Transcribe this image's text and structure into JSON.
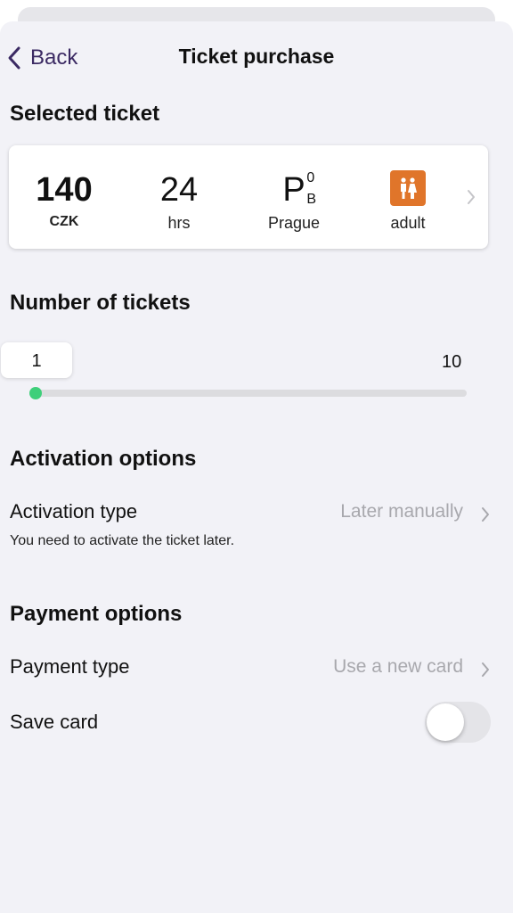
{
  "nav": {
    "back_label": "Back",
    "title": "Ticket purchase"
  },
  "selected_ticket": {
    "heading": "Selected ticket",
    "price": "140",
    "currency": "CZK",
    "duration": "24",
    "duration_unit": "hrs",
    "zone_letter": "P",
    "zone_sup": "0",
    "zone_sub": "B",
    "zone_name": "Prague",
    "passenger_icon": "adult-passenger-icon",
    "passenger_type": "adult",
    "accent_color": "#e0752a"
  },
  "tickets_count": {
    "heading": "Number of tickets",
    "value": "1",
    "max": "10",
    "thumb_color": "#3ecf7a"
  },
  "activation": {
    "heading": "Activation options",
    "type_label": "Activation type",
    "type_value": "Later manually",
    "note": "You need to activate the ticket later."
  },
  "payment": {
    "heading": "Payment options",
    "type_label": "Payment type",
    "type_value": "Use a new card",
    "save_card_label": "Save card",
    "save_card_enabled": false
  }
}
